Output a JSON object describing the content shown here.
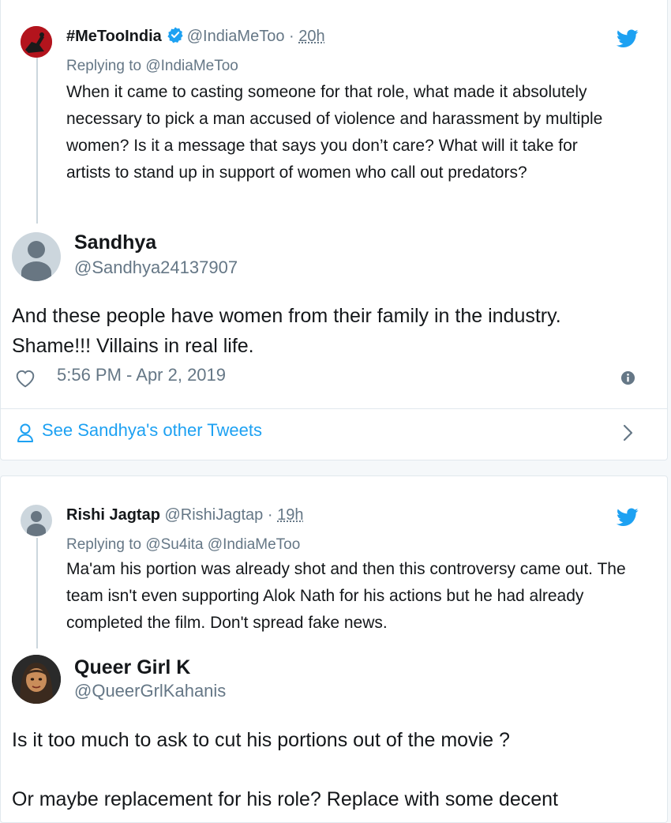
{
  "tweet1": {
    "quoted": {
      "display_name": "#MeTooIndia",
      "handle": "@IndiaMeToo",
      "separator": "·",
      "time": "20h",
      "replying_label": "Replying to",
      "replying_to": "@IndiaMeToo",
      "text": "When it came to casting someone for that role, what made it absolutely necessary to pick a man accused of violence and harassment by multiple women? Is it a message that says you don’t care? What will it take for artists to stand up in support of women who call out predators?"
    },
    "author": {
      "display_name": "Sandhya",
      "handle": "@Sandhya24137907"
    },
    "text_line1": "And these people have women from their family in the industry.",
    "text_line2": "Shame!!! Villains in real life.",
    "timestamp": "5:56 PM - Apr 2, 2019",
    "see_other": "See Sandhya's other Tweets",
    "icons": {
      "like": "heart-icon",
      "info": "info-icon",
      "person": "person-icon",
      "chevron": "chevron-right-icon",
      "brand": "twitter-bird-icon"
    }
  },
  "tweet2": {
    "quoted": {
      "display_name": "Rishi Jagtap",
      "handle": "@RishiJagtap",
      "separator": "·",
      "time": "19h",
      "replying_label": "Replying to",
      "replying_to": "@Su4ita @IndiaMeToo",
      "text": "Ma'am his portion was already shot and then this controversy came out. The team isn't even supporting Alok Nath for his actions but he had already completed the film. Don't spread fake news."
    },
    "author": {
      "display_name": "Queer Girl K",
      "handle": "@QueerGrlKahanis"
    },
    "text_para1": "Is it too much to ask to cut his portions out of the movie ?",
    "text_para2": "Or maybe replacement for his role? Replace with some decent"
  },
  "colors": {
    "twitter_blue": "#1da1f2",
    "muted": "#657786",
    "text": "#14171a",
    "border": "#e1e8ed"
  }
}
